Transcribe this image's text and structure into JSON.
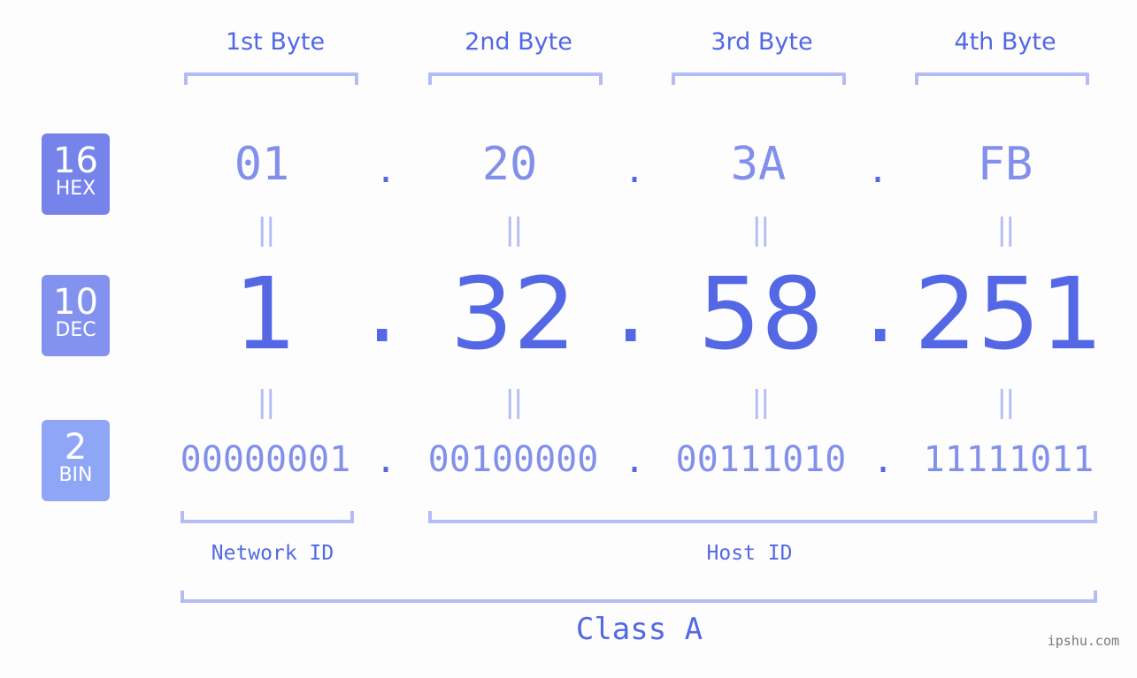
{
  "bytes": [
    {
      "label": "1st Byte",
      "hex": "01",
      "dec": "1",
      "bin": "00000001"
    },
    {
      "label": "2nd Byte",
      "hex": "20",
      "dec": "32",
      "bin": "00100000"
    },
    {
      "label": "3rd Byte",
      "hex": "3A",
      "dec": "58",
      "bin": "00111010"
    },
    {
      "label": "4th Byte",
      "hex": "FB",
      "dec": "251",
      "bin": "11111011"
    }
  ],
  "separator": ".",
  "equals": "||",
  "bases": {
    "hex": {
      "number": "16",
      "label": "HEX",
      "color": "#7583ea"
    },
    "dec": {
      "number": "10",
      "label": "DEC",
      "color": "#8492ef"
    },
    "bin": {
      "number": "2",
      "label": "BIN",
      "color": "#8fa6f6"
    }
  },
  "segments": {
    "network": "Network ID",
    "host": "Host ID",
    "class": "Class A"
  },
  "watermark": "ipshu.com",
  "colors": {
    "accent": "#5468e6",
    "light_value": "#8390eb",
    "bracket": "#b3bcf5",
    "background": "#fcfdfc"
  }
}
